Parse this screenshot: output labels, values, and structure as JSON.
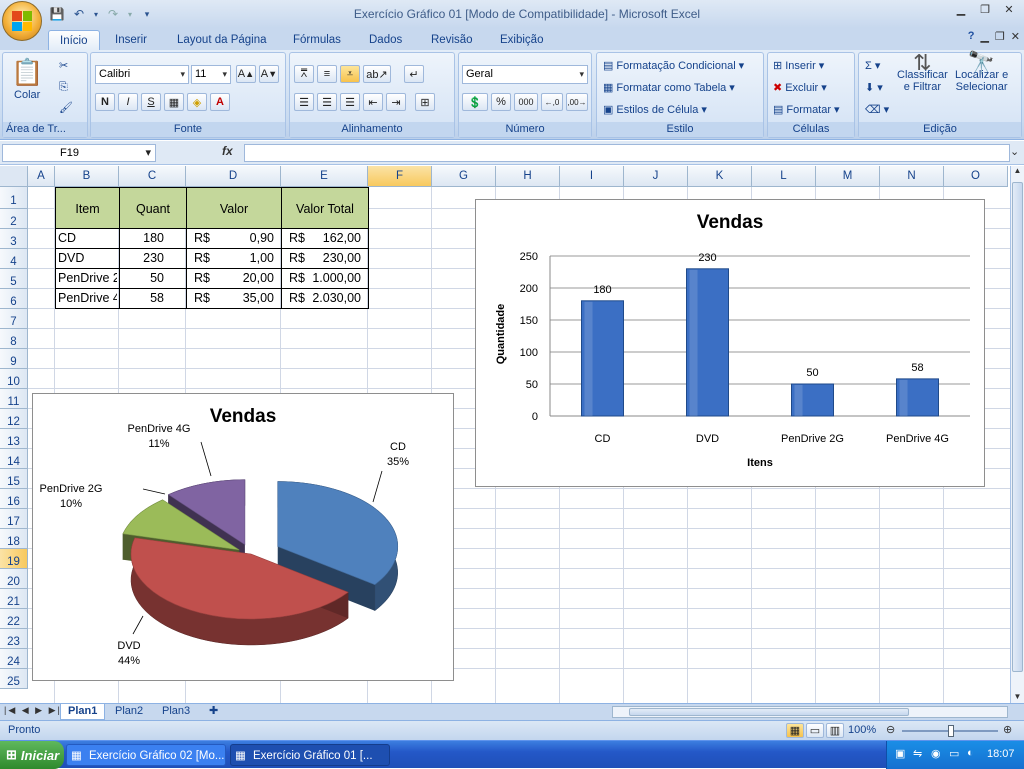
{
  "window": {
    "title": "Exercício Gráfico 01  [Modo de Compatibilidade] - Microsoft Excel"
  },
  "ribbon_tabs": [
    "Início",
    "Inserir",
    "Layout da Página",
    "Fórmulas",
    "Dados",
    "Revisão",
    "Exibição"
  ],
  "ribbon": {
    "clipboard": {
      "paste_label": "Colar",
      "group_label": "Área de Tr..."
    },
    "font": {
      "name": "Calibri",
      "size": "11",
      "group_label": "Fonte"
    },
    "alignment": {
      "group_label": "Alinhamento"
    },
    "number": {
      "format": "Geral",
      "group_label": "Número",
      "percent": "%",
      "thousands": "000",
      "dec_inc": ",0 ,00",
      "dec_dec": ",00 ,0"
    },
    "styles": {
      "conditional": "Formatação Condicional",
      "as_table": "Formatar como Tabela",
      "cell_styles": "Estilos de Célula",
      "group_label": "Estilo"
    },
    "cells": {
      "insert": "Inserir",
      "delete": "Excluir",
      "format": "Formatar",
      "group_label": "Células"
    },
    "editing": {
      "sort": "Classificar",
      "sort2": "e Filtrar",
      "find": "Localizar e",
      "find2": "Selecionar",
      "group_label": "Edição"
    }
  },
  "formula_bar": {
    "name_box": "F19",
    "fx": "fx",
    "formula": ""
  },
  "columns": [
    "A",
    "B",
    "C",
    "D",
    "E",
    "F",
    "G",
    "H",
    "I",
    "J",
    "K",
    "L",
    "M",
    "N",
    "O"
  ],
  "rows": [
    "1",
    "2",
    "3",
    "4",
    "5",
    "6",
    "7",
    "8",
    "9",
    "10",
    "11",
    "12",
    "13",
    "14",
    "15",
    "16",
    "17",
    "18",
    "19",
    "20",
    "21",
    "22",
    "23",
    "24",
    "25"
  ],
  "table": {
    "headers": [
      "Item",
      "Quant",
      "Valor",
      "Valor Total"
    ],
    "rows": [
      {
        "item": "CD",
        "quant": "180",
        "cur": "R$",
        "valor": "0,90",
        "cur2": "R$",
        "total": "162,00"
      },
      {
        "item": "DVD",
        "quant": "230",
        "cur": "R$",
        "valor": "1,00",
        "cur2": "R$",
        "total": "230,00"
      },
      {
        "item": "PenDrive 2G",
        "quant": "50",
        "cur": "R$",
        "valor": "20,00",
        "cur2": "R$",
        "total": "1.000,00"
      },
      {
        "item": "PenDrive 4G",
        "quant": "58",
        "cur": "R$",
        "valor": "35,00",
        "cur2": "R$",
        "total": "2.030,00"
      }
    ]
  },
  "chart_data": [
    {
      "type": "bar",
      "title": "Vendas",
      "xlabel": "Itens",
      "ylabel": "Quantidade",
      "categories": [
        "CD",
        "DVD",
        "PenDrive 2G",
        "PenDrive 4G"
      ],
      "values": [
        180,
        230,
        50,
        58
      ],
      "ylim": [
        0,
        250
      ],
      "yticks": [
        0,
        50,
        100,
        150,
        200,
        250
      ],
      "grid": true,
      "color": "#3b6fc4"
    },
    {
      "type": "pie",
      "title": "Vendas",
      "categories": [
        "CD",
        "DVD",
        "PenDrive 2G",
        "PenDrive 4G"
      ],
      "values": [
        35,
        44,
        10,
        11
      ],
      "labels": [
        "35%",
        "44%",
        "10%",
        "11%"
      ],
      "colors": [
        "#4f81bd",
        "#c0504d",
        "#9bbb59",
        "#8064a2"
      ]
    }
  ],
  "sheet_tabs": [
    "Plan1",
    "Plan2",
    "Plan3"
  ],
  "status": {
    "ready": "Pronto",
    "zoom": "100%"
  },
  "taskbar": {
    "start": "Iniciar",
    "task1": "Exercício Gráfico 02  [Mo...",
    "task2": "Exercício Gráfico 01  [...",
    "clock": "18:07"
  }
}
